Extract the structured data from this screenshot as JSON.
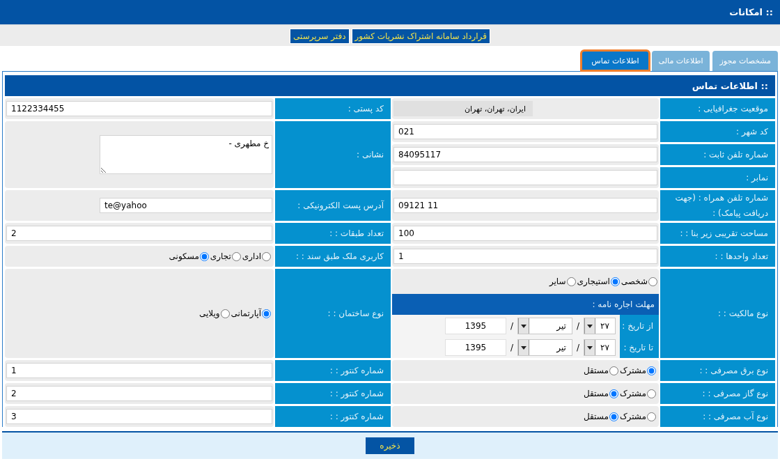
{
  "header": {
    "title": ":: امکانات"
  },
  "nav_links": [
    "قرارداد سامانه اشتراک نشریات کشور",
    "دفتر سرپرستی"
  ],
  "tabs": [
    {
      "label": "مشخصات مجوز",
      "selected": false
    },
    {
      "label": "اطلاعات مالی",
      "selected": false
    },
    {
      "label": "اطلاعات تماس",
      "selected": true
    }
  ],
  "section_title": ":: اطلاعات تماس",
  "rows": [
    {
      "right": [
        {
          "label": "موقعیت جغرافیایی :",
          "kind": "static",
          "value": "ایران، تهران، تهران"
        }
      ],
      "left": {
        "label": "کد پستی :",
        "kind": "text",
        "value": "1122334455"
      }
    },
    {
      "right": [
        {
          "label": "کد شهر :",
          "kind": "text",
          "value": "021"
        },
        {
          "label": "شماره تلفن ثابت :",
          "kind": "text",
          "value": "84095117"
        },
        {
          "label": "نمابر :",
          "kind": "text"
        }
      ],
      "left": {
        "label": "نشانی :",
        "kind": "textarea",
        "value": "خ مطهری -"
      }
    },
    {
      "right": [
        {
          "label": "شماره تلفن همراه : (جهت دریافت پیامک) :",
          "kind": "text",
          "value": "09121 11"
        }
      ],
      "left": {
        "label": "آدرس پست الکترونیکی :",
        "kind": "short_text",
        "value": "te@yahoo"
      }
    },
    {
      "right": [
        {
          "label": "مساحت تقریبی زیر بنا : :",
          "kind": "text",
          "value": "100"
        }
      ],
      "left": {
        "label": "تعداد طبقات : :",
        "kind": "text",
        "value": "2"
      }
    },
    {
      "right": [
        {
          "label": "تعداد واحدها : :",
          "kind": "text",
          "value": "1"
        }
      ],
      "left": {
        "label": "کاربری ملک طبق سند : :",
        "kind": "radio",
        "options": [
          {
            "label": "اداری",
            "selected": false
          },
          {
            "label": "تجاری",
            "selected": false
          },
          {
            "label": "مسکونی",
            "selected": true
          }
        ]
      }
    },
    {
      "right": [
        {
          "label": "نوع مالکیت : :",
          "kind": "ownership",
          "options": [
            {
              "label": "شخصی",
              "selected": false
            },
            {
              "label": "استیجاری",
              "selected": true
            },
            {
              "label": "سایر",
              "selected": false
            }
          ],
          "lease": {
            "title": "مهلت اجاره نامه :",
            "dates": [
              {
                "label": "از تاریخ :",
                "day": "۲۷",
                "sep1": "/",
                "month": "تیر",
                "sep2": "/",
                "year": "1395"
              },
              {
                "label": "تا تاریخ :",
                "day": "۲۷",
                "sep1": "/",
                "month": "تیر",
                "sep2": "/",
                "year": "1395"
              }
            ]
          }
        }
      ],
      "left": {
        "label": "نوع ساختمان : :",
        "kind": "radio",
        "options": [
          {
            "label": "آپارتمانی",
            "selected": true
          },
          {
            "label": "ویلایی",
            "selected": false
          }
        ]
      }
    },
    {
      "right": [
        {
          "label": "نوع برق مصرفی : :",
          "kind": "radio",
          "options": [
            {
              "label": "مشترک",
              "selected": true
            },
            {
              "label": "مستقل",
              "selected": false
            }
          ]
        }
      ],
      "left": {
        "label": "شماره کنتور : :",
        "kind": "text",
        "value": "1"
      }
    },
    {
      "right": [
        {
          "label": "نوع گاز مصرفی : :",
          "kind": "radio",
          "options": [
            {
              "label": "مشترک",
              "selected": false
            },
            {
              "label": "مستقل",
              "selected": true
            }
          ]
        }
      ],
      "left": {
        "label": "شماره کنتور : :",
        "kind": "text",
        "value": "2"
      }
    },
    {
      "right": [
        {
          "label": "نوع آب مصرفی : :",
          "kind": "radio",
          "options": [
            {
              "label": "مشترک",
              "selected": false
            },
            {
              "label": "مستقل",
              "selected": true
            }
          ]
        }
      ],
      "left": {
        "label": "شماره کنتور : :",
        "kind": "text",
        "value": "3"
      }
    }
  ],
  "save_button": "ذخیره"
}
